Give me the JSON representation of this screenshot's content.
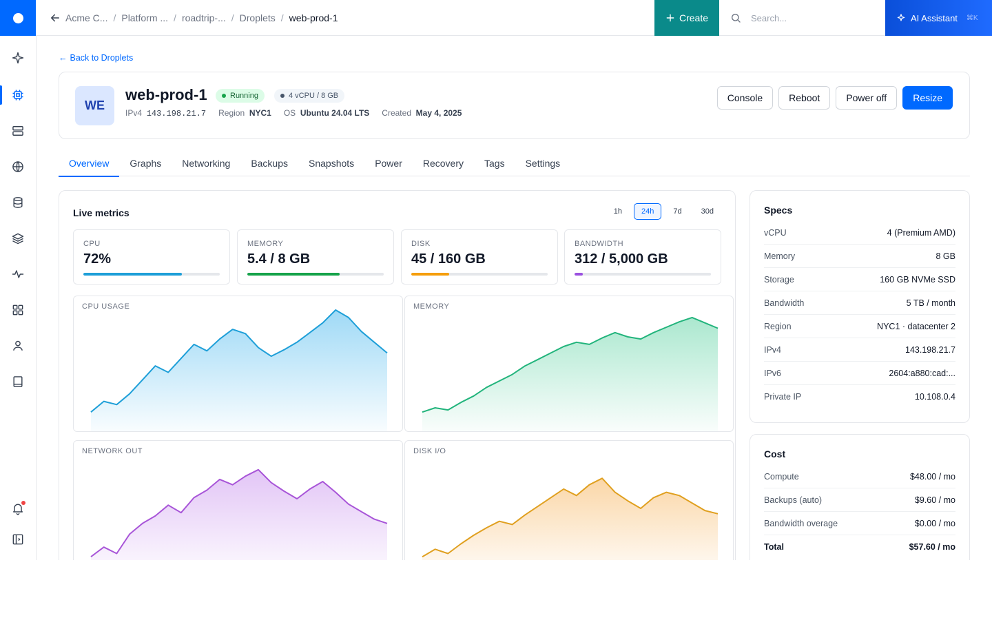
{
  "breadcrumbs": [
    "Acme C...",
    "Platform ...",
    "roadtrip-...",
    "Droplets",
    "web-prod-1"
  ],
  "topbar": {
    "create_label": "Create",
    "search_placeholder": "Search...",
    "ai_label": "AI Assistant",
    "ai_shortcut": "⌘K"
  },
  "sidebar": {
    "icons": [
      "sparkle-icon",
      "chip-icon",
      "server-icon",
      "globe-icon",
      "database-icon",
      "layers-icon",
      "activity-icon",
      "grid-icon",
      "user-icon",
      "book-icon",
      "bell-icon",
      "collapse-panel-icon"
    ],
    "active": "chip-icon"
  },
  "droplet": {
    "back_label": "Back to Droplets",
    "avatar": "WE",
    "name": "web-prod-1",
    "status": "Running",
    "spec_badge": "4 vCPU / 8 GB",
    "meta": [
      {
        "label": "IPv4",
        "value": "143.198.21.7"
      },
      {
        "label": "Region",
        "value": "NYC1"
      },
      {
        "label": "OS",
        "value": "Ubuntu 24.04 LTS"
      },
      {
        "label": "Created",
        "value": "May 4, 2025"
      }
    ],
    "actions": [
      "Console",
      "Reboot",
      "Power off",
      "Resize"
    ]
  },
  "tabs": [
    "Overview",
    "Graphs",
    "Networking",
    "Backups",
    "Snapshots",
    "Power",
    "Recovery",
    "Tags",
    "Settings"
  ],
  "active_tab": "Overview",
  "metrics": {
    "title": "Live metrics",
    "ranges": [
      "1h",
      "24h",
      "7d",
      "30d"
    ],
    "selected_range": "24h",
    "stats": [
      {
        "label": "CPU",
        "value": "72%",
        "fill": 0.72,
        "color": "#1e9fd8"
      },
      {
        "label": "MEMORY",
        "value": "5.4 / 8 GB",
        "fill": 0.675,
        "color": "#16a34a"
      },
      {
        "label": "DISK",
        "value": "45 / 160 GB",
        "fill": 0.28,
        "color": "#f59e0b"
      },
      {
        "label": "BANDWIDTH",
        "value": "312 / 5,000 GB",
        "fill": 0.062,
        "color": "#9b51e0"
      }
    ]
  },
  "chart_data": [
    {
      "type": "area",
      "title": "CPU USAGE",
      "color": "#1e9fd8",
      "fill": "#7fcdf3",
      "values": [
        5,
        15,
        12,
        22,
        35,
        48,
        42,
        55,
        68,
        62,
        73,
        82,
        78,
        65,
        57,
        63,
        70,
        79,
        88,
        100,
        93,
        80,
        70,
        60
      ]
    },
    {
      "type": "area",
      "title": "MEMORY",
      "color": "#22b47c",
      "fill": "#8fe0bf",
      "values": [
        5,
        9,
        7,
        14,
        20,
        28,
        34,
        40,
        48,
        54,
        60,
        66,
        70,
        68,
        74,
        79,
        75,
        73,
        79,
        84,
        89,
        93,
        88,
        83
      ]
    },
    {
      "type": "area",
      "title": "NETWORK OUT",
      "color": "#a855d8",
      "fill": "#d9b2f3",
      "values": [
        5,
        14,
        8,
        26,
        36,
        43,
        53,
        46,
        60,
        67,
        77,
        72,
        80,
        86,
        74,
        66,
        59,
        68,
        75,
        65,
        54,
        47,
        40,
        36
      ]
    },
    {
      "type": "area",
      "title": "DISK I/O",
      "color": "#e0a020",
      "fill": "#f9c98a",
      "values": [
        5,
        12,
        8,
        17,
        25,
        32,
        38,
        35,
        44,
        52,
        60,
        68,
        62,
        72,
        78,
        65,
        57,
        50,
        60,
        65,
        62,
        55,
        48,
        45
      ]
    }
  ],
  "specs": {
    "title": "Specs",
    "rows": [
      {
        "k": "vCPU",
        "v": "4 (Premium AMD)"
      },
      {
        "k": "Memory",
        "v": "8 GB"
      },
      {
        "k": "Storage",
        "v": "160 GB NVMe SSD"
      },
      {
        "k": "Bandwidth",
        "v": "5 TB / month"
      },
      {
        "k": "Region",
        "v": "NYC1 · datacenter 2"
      },
      {
        "k": "IPv4",
        "v": "143.198.21.7"
      },
      {
        "k": "IPv6",
        "v": "2604:a880:cad:..."
      },
      {
        "k": "Private IP",
        "v": "10.108.0.4"
      }
    ]
  },
  "cost": {
    "title": "Cost",
    "rows": [
      {
        "k": "Compute",
        "v": "$48.00 / mo"
      },
      {
        "k": "Backups (auto)",
        "v": "$9.60 / mo"
      },
      {
        "k": "Bandwidth overage",
        "v": "$0.00 / mo"
      },
      {
        "k": "Total",
        "v": "$57.60 / mo"
      }
    ]
  }
}
